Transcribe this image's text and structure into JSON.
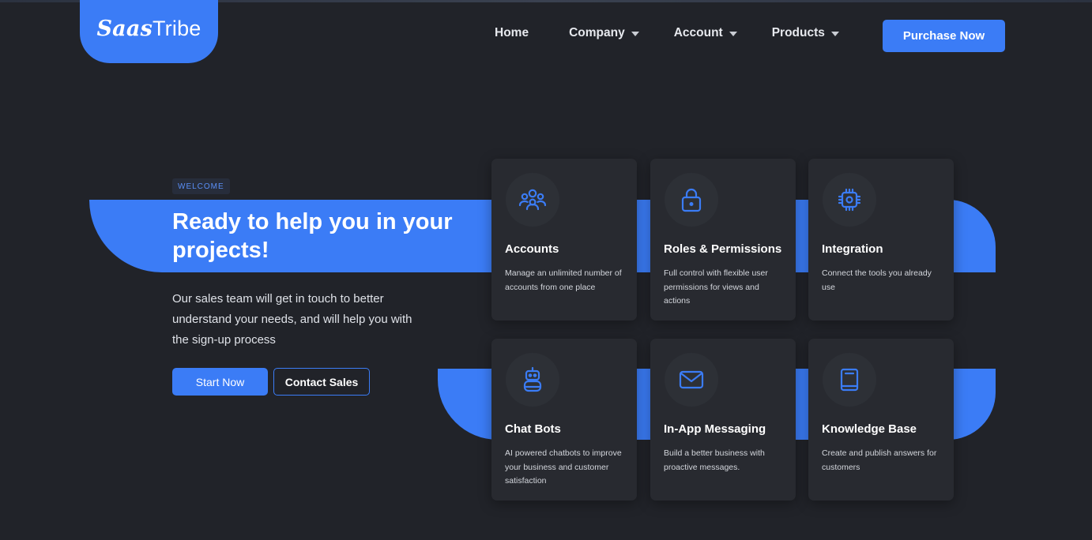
{
  "brand": {
    "logo_script": "Saas",
    "logo_plain": "Tribe",
    "accent_color": "#3b7cf6",
    "background_color": "#212329"
  },
  "nav": {
    "items": [
      {
        "label": "Home",
        "has_dropdown": false
      },
      {
        "label": "Company",
        "has_dropdown": true
      },
      {
        "label": "Account",
        "has_dropdown": true
      },
      {
        "label": "Products",
        "has_dropdown": true
      }
    ],
    "cta_label": "Purchase Now"
  },
  "hero": {
    "badge": "WELCOME",
    "title": "Ready to help you in your projects!",
    "description": "Our sales team will get in touch to better understand your needs, and will help you with the sign-up process",
    "primary_button": "Start Now",
    "secondary_button": "Contact Sales"
  },
  "features": [
    {
      "icon": "users-icon",
      "title": "Accounts",
      "description": "Manage an unlimited number of accounts from one place"
    },
    {
      "icon": "lock-icon",
      "title": "Roles & Permissions",
      "description": "Full control with flexible user permissions for views and actions"
    },
    {
      "icon": "chip-icon",
      "title": "Integration",
      "description": "Connect the tools you already use"
    },
    {
      "icon": "robot-icon",
      "title": "Chat Bots",
      "description": "AI powered chatbots to improve your business and customer satisfaction"
    },
    {
      "icon": "mail-icon",
      "title": "In-App Messaging",
      "description": "Build a better business with proactive messages."
    },
    {
      "icon": "book-icon",
      "title": "Knowledge Base",
      "description": "Create and publish answers for customers"
    }
  ]
}
